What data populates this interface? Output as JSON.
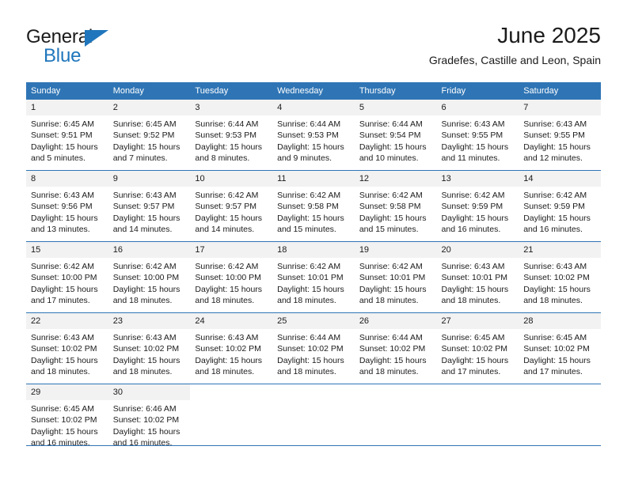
{
  "brand": {
    "name_part1": "General",
    "name_part2": "Blue",
    "accent_color": "#1f76bc"
  },
  "header": {
    "month_title": "June 2025",
    "location": "Gradefes, Castille and Leon, Spain"
  },
  "theme": {
    "header_blue": "#2f75b5",
    "daynum_band": "#f2f2f2",
    "text": "#1b1b1b"
  },
  "calendar": {
    "weekday_headers": [
      "Sunday",
      "Monday",
      "Tuesday",
      "Wednesday",
      "Thursday",
      "Friday",
      "Saturday"
    ],
    "weeks": [
      [
        {
          "day": "1",
          "sunrise": "Sunrise: 6:45 AM",
          "sunset": "Sunset: 9:51 PM",
          "daylight": "Daylight: 15 hours and 5 minutes."
        },
        {
          "day": "2",
          "sunrise": "Sunrise: 6:45 AM",
          "sunset": "Sunset: 9:52 PM",
          "daylight": "Daylight: 15 hours and 7 minutes."
        },
        {
          "day": "3",
          "sunrise": "Sunrise: 6:44 AM",
          "sunset": "Sunset: 9:53 PM",
          "daylight": "Daylight: 15 hours and 8 minutes."
        },
        {
          "day": "4",
          "sunrise": "Sunrise: 6:44 AM",
          "sunset": "Sunset: 9:53 PM",
          "daylight": "Daylight: 15 hours and 9 minutes."
        },
        {
          "day": "5",
          "sunrise": "Sunrise: 6:44 AM",
          "sunset": "Sunset: 9:54 PM",
          "daylight": "Daylight: 15 hours and 10 minutes."
        },
        {
          "day": "6",
          "sunrise": "Sunrise: 6:43 AM",
          "sunset": "Sunset: 9:55 PM",
          "daylight": "Daylight: 15 hours and 11 minutes."
        },
        {
          "day": "7",
          "sunrise": "Sunrise: 6:43 AM",
          "sunset": "Sunset: 9:55 PM",
          "daylight": "Daylight: 15 hours and 12 minutes."
        }
      ],
      [
        {
          "day": "8",
          "sunrise": "Sunrise: 6:43 AM",
          "sunset": "Sunset: 9:56 PM",
          "daylight": "Daylight: 15 hours and 13 minutes."
        },
        {
          "day": "9",
          "sunrise": "Sunrise: 6:43 AM",
          "sunset": "Sunset: 9:57 PM",
          "daylight": "Daylight: 15 hours and 14 minutes."
        },
        {
          "day": "10",
          "sunrise": "Sunrise: 6:42 AM",
          "sunset": "Sunset: 9:57 PM",
          "daylight": "Daylight: 15 hours and 14 minutes."
        },
        {
          "day": "11",
          "sunrise": "Sunrise: 6:42 AM",
          "sunset": "Sunset: 9:58 PM",
          "daylight": "Daylight: 15 hours and 15 minutes."
        },
        {
          "day": "12",
          "sunrise": "Sunrise: 6:42 AM",
          "sunset": "Sunset: 9:58 PM",
          "daylight": "Daylight: 15 hours and 15 minutes."
        },
        {
          "day": "13",
          "sunrise": "Sunrise: 6:42 AM",
          "sunset": "Sunset: 9:59 PM",
          "daylight": "Daylight: 15 hours and 16 minutes."
        },
        {
          "day": "14",
          "sunrise": "Sunrise: 6:42 AM",
          "sunset": "Sunset: 9:59 PM",
          "daylight": "Daylight: 15 hours and 16 minutes."
        }
      ],
      [
        {
          "day": "15",
          "sunrise": "Sunrise: 6:42 AM",
          "sunset": "Sunset: 10:00 PM",
          "daylight": "Daylight: 15 hours and 17 minutes."
        },
        {
          "day": "16",
          "sunrise": "Sunrise: 6:42 AM",
          "sunset": "Sunset: 10:00 PM",
          "daylight": "Daylight: 15 hours and 18 minutes."
        },
        {
          "day": "17",
          "sunrise": "Sunrise: 6:42 AM",
          "sunset": "Sunset: 10:00 PM",
          "daylight": "Daylight: 15 hours and 18 minutes."
        },
        {
          "day": "18",
          "sunrise": "Sunrise: 6:42 AM",
          "sunset": "Sunset: 10:01 PM",
          "daylight": "Daylight: 15 hours and 18 minutes."
        },
        {
          "day": "19",
          "sunrise": "Sunrise: 6:42 AM",
          "sunset": "Sunset: 10:01 PM",
          "daylight": "Daylight: 15 hours and 18 minutes."
        },
        {
          "day": "20",
          "sunrise": "Sunrise: 6:43 AM",
          "sunset": "Sunset: 10:01 PM",
          "daylight": "Daylight: 15 hours and 18 minutes."
        },
        {
          "day": "21",
          "sunrise": "Sunrise: 6:43 AM",
          "sunset": "Sunset: 10:02 PM",
          "daylight": "Daylight: 15 hours and 18 minutes."
        }
      ],
      [
        {
          "day": "22",
          "sunrise": "Sunrise: 6:43 AM",
          "sunset": "Sunset: 10:02 PM",
          "daylight": "Daylight: 15 hours and 18 minutes."
        },
        {
          "day": "23",
          "sunrise": "Sunrise: 6:43 AM",
          "sunset": "Sunset: 10:02 PM",
          "daylight": "Daylight: 15 hours and 18 minutes."
        },
        {
          "day": "24",
          "sunrise": "Sunrise: 6:43 AM",
          "sunset": "Sunset: 10:02 PM",
          "daylight": "Daylight: 15 hours and 18 minutes."
        },
        {
          "day": "25",
          "sunrise": "Sunrise: 6:44 AM",
          "sunset": "Sunset: 10:02 PM",
          "daylight": "Daylight: 15 hours and 18 minutes."
        },
        {
          "day": "26",
          "sunrise": "Sunrise: 6:44 AM",
          "sunset": "Sunset: 10:02 PM",
          "daylight": "Daylight: 15 hours and 18 minutes."
        },
        {
          "day": "27",
          "sunrise": "Sunrise: 6:45 AM",
          "sunset": "Sunset: 10:02 PM",
          "daylight": "Daylight: 15 hours and 17 minutes."
        },
        {
          "day": "28",
          "sunrise": "Sunrise: 6:45 AM",
          "sunset": "Sunset: 10:02 PM",
          "daylight": "Daylight: 15 hours and 17 minutes."
        }
      ],
      [
        {
          "day": "29",
          "sunrise": "Sunrise: 6:45 AM",
          "sunset": "Sunset: 10:02 PM",
          "daylight": "Daylight: 15 hours and 16 minutes."
        },
        {
          "day": "30",
          "sunrise": "Sunrise: 6:46 AM",
          "sunset": "Sunset: 10:02 PM",
          "daylight": "Daylight: 15 hours and 16 minutes."
        },
        {
          "day": "",
          "sunrise": "",
          "sunset": "",
          "daylight": ""
        },
        {
          "day": "",
          "sunrise": "",
          "sunset": "",
          "daylight": ""
        },
        {
          "day": "",
          "sunrise": "",
          "sunset": "",
          "daylight": ""
        },
        {
          "day": "",
          "sunrise": "",
          "sunset": "",
          "daylight": ""
        },
        {
          "day": "",
          "sunrise": "",
          "sunset": "",
          "daylight": ""
        }
      ]
    ]
  }
}
